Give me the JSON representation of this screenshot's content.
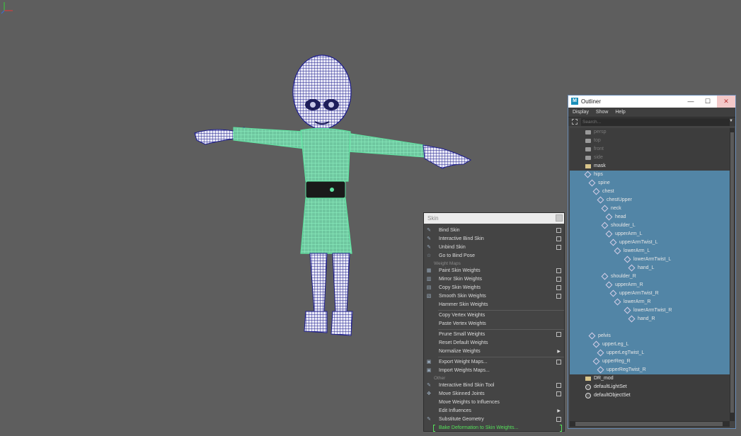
{
  "skin_menu": {
    "title": "Skin",
    "sections": {
      "weight_maps": "Weight Maps",
      "other": "Other"
    },
    "items": {
      "bind_skin": "Bind Skin",
      "interactive_bind_skin": "Interactive Bind Skin",
      "unbind_skin": "Unbind Skin",
      "go_to_bind_pose": "Go to Bind Pose",
      "paint_skin_weights": "Paint Skin Weights",
      "mirror_skin_weights": "Mirror Skin Weights",
      "copy_skin_weights": "Copy Skin Weights",
      "smooth_skin_weights": "Smooth Skin Weights",
      "hammer_skin_weights": "Hammer Skin Weights",
      "copy_vertex_weights": "Copy Vertex Weights",
      "paste_vertex_weights": "Paste Vertex Weights",
      "prune_small_weights": "Prune Small Weights",
      "reset_default_weights": "Reset Default Weights",
      "normalize_weights": "Normalize Weights",
      "export_weight_maps": "Export Weight Maps...",
      "import_weights_maps": "Import Weights Maps...",
      "interactive_bind_skin_tool": "Interactive Bind Skin Tool",
      "move_skinned_joints": "Move Skinned Joints",
      "move_weights_to_influences": "Move Weights to Influences",
      "edit_influences": "Edit Influences",
      "substitute_geometry": "Substitute Geometry",
      "bake_deformation": "Bake Deformation to Skin Weights..."
    }
  },
  "outliner": {
    "title": "Outliner",
    "logo": "M",
    "window_buttons": {
      "minimize": "—",
      "maximize": "☐",
      "close": "✕"
    },
    "menu": {
      "display": "Display",
      "show": "Show",
      "help": "Help"
    },
    "search_placeholder": "Search...",
    "tree": {
      "persp": "persp",
      "top": "top",
      "front": "front",
      "side": "side",
      "mask": "mask",
      "hips": "hips",
      "spine": "spine",
      "chest": "chest",
      "chestUpper": "chestUpper",
      "neck": "neck",
      "head": "head",
      "shoulder_L": "shoulder_L",
      "upperArm_L": "upperArm_L",
      "upperArmTwist_L": "upperArmTwist_L",
      "lowerArm_L": "lowerArm_L",
      "lowerArmTwist_L": "lowerArmTwist_L",
      "hand_L": "hand_L",
      "shoulder_R": "shoulder_R",
      "upperArm_R": "upperArm_R",
      "upperArmTwist_R": "upperArmTwist_R",
      "lowerArm_R": "lowerArm_R",
      "lowerArmTwist_R": "lowerArmTwist_R",
      "hand_R": "hand_R",
      "pelvis": "pelvis",
      "upperLeg_L": "upperLeg_L",
      "upperLegTwist_L": "upperLegTwist_L",
      "upperReg_R": "upperReg_R",
      "upperRegTwist_R": "upperRegTwist_R",
      "DR_mod": "DR_mod",
      "defaultLightSet": "defaultLightSet",
      "defaultObjectSet": "defaultObjectSet"
    }
  },
  "colors": {
    "viewport_bg": "#5e5e5e",
    "wireframe": "#1c1c8c",
    "skin_fill": "#dcdcf2",
    "selected_mesh": "#5fe3a1",
    "outliner_selection": "#5285a6",
    "menu_highlight_text": "#55e05a"
  }
}
